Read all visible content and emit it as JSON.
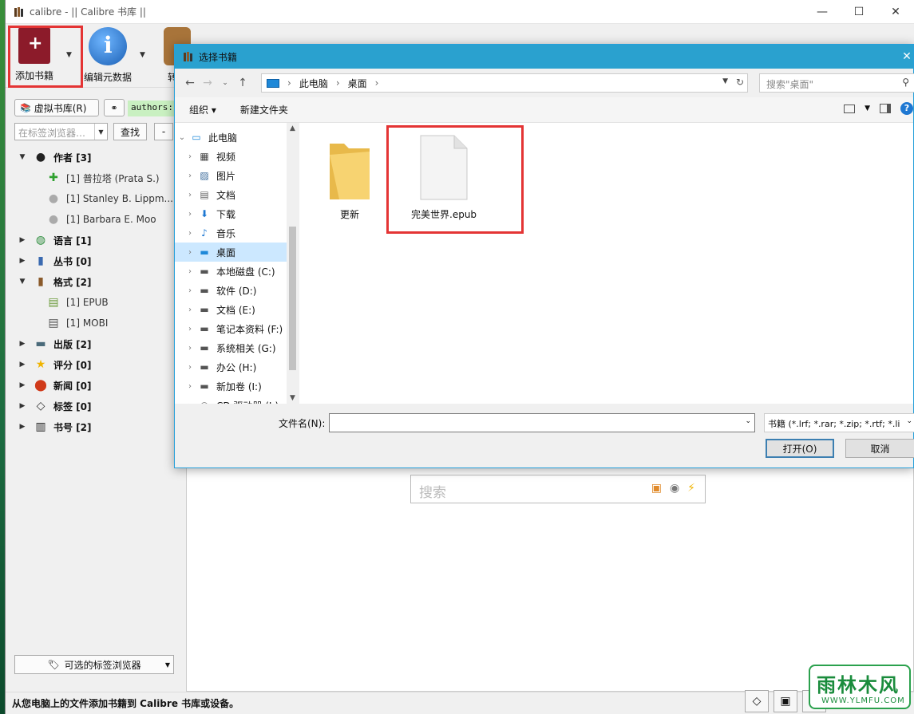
{
  "app": {
    "title": "calibre - || Calibre 书库 ||",
    "win_min": "—",
    "win_max": "☐",
    "win_close": "✕"
  },
  "toolbar": {
    "add_books": "添加书籍",
    "edit_metadata": "编辑元数据",
    "convert": "转换"
  },
  "left": {
    "virtual_library": "虚拟书库(R)",
    "search_text": "authors:\"",
    "tag_search_placeholder": "在标签浏览器…",
    "find": "查找",
    "minus": "-",
    "tree": [
      {
        "label": "作者 [3]",
        "icon": "person-icon",
        "expanded": true
      },
      {
        "label": "[1] 普拉塔 (Prata S.)",
        "child": true,
        "icon": "green-plus-icon"
      },
      {
        "label": "[1] Stanley B. Lippm...",
        "child": true,
        "icon": "person-gray-icon"
      },
      {
        "label": "[1] Barbara E. Moo",
        "child": true,
        "icon": "person-gray-icon"
      },
      {
        "label": "语言 [1]",
        "icon": "globe-icon"
      },
      {
        "label": "丛书 [0]",
        "icon": "series-icon"
      },
      {
        "label": "格式 [2]",
        "icon": "book-brown-icon",
        "expanded": true
      },
      {
        "label": "[1] EPUB",
        "child": true,
        "icon": "epub-icon"
      },
      {
        "label": "[1] MOBI",
        "child": true,
        "icon": "mobi-icon"
      },
      {
        "label": "出版 [2]",
        "icon": "publisher-icon"
      },
      {
        "label": "评分 [0]",
        "icon": "star-icon"
      },
      {
        "label": "新闻 [0]",
        "icon": "news-icon"
      },
      {
        "label": "标签 [0]",
        "icon": "tag-icon"
      },
      {
        "label": "书号 [2]",
        "icon": "barcode-icon"
      }
    ],
    "tag_browser_button": "可选的标签浏览器"
  },
  "center": {
    "search_placeholder": "搜索"
  },
  "status": {
    "message": "从您电脑上的文件添加书籍到 Calibre 书库或设备。"
  },
  "dialog": {
    "title": "选择书籍",
    "breadcrumb": [
      "此电脑",
      "桌面"
    ],
    "search_placeholder": "搜索\"桌面\"",
    "organize": "组织 ▾",
    "new_folder": "新建文件夹",
    "nav": [
      {
        "label": "此电脑",
        "icon": "computer-icon",
        "expanded": true,
        "level": 0
      },
      {
        "label": "视频",
        "icon": "video-icon"
      },
      {
        "label": "图片",
        "icon": "picture-icon"
      },
      {
        "label": "文档",
        "icon": "document-icon"
      },
      {
        "label": "下载",
        "icon": "download-icon"
      },
      {
        "label": "音乐",
        "icon": "music-icon"
      },
      {
        "label": "桌面",
        "icon": "desktop-icon",
        "selected": true
      },
      {
        "label": "本地磁盘 (C:)",
        "icon": "drive-icon"
      },
      {
        "label": "软件 (D:)",
        "icon": "drive-icon"
      },
      {
        "label": "文档 (E:)",
        "icon": "drive-icon"
      },
      {
        "label": "笔记本资料 (F:)",
        "icon": "drive-icon"
      },
      {
        "label": "系统相关 (G:)",
        "icon": "drive-icon"
      },
      {
        "label": "办公 (H:)",
        "icon": "drive-icon"
      },
      {
        "label": "新加卷 (I:)",
        "icon": "drive-icon"
      },
      {
        "label": "CD 驱动器 (J:)",
        "icon": "cd-icon"
      }
    ],
    "files": [
      {
        "name": "更新",
        "type": "folder"
      },
      {
        "name": "完美世界.epub",
        "type": "file"
      }
    ],
    "filename_label": "文件名(N):",
    "filename_value": "",
    "filetype": "书籍 (*.lrf; *.rar; *.zip; *.rtf; *.li",
    "open": "打开(O)",
    "cancel": "取消"
  },
  "watermark": {
    "title": "雨林木风",
    "url": "WWW.YLMFU.COM"
  },
  "colors": {
    "highlight_red": "#e43434",
    "dialog_title": "#2aa1cf",
    "selection": "#cce8ff"
  }
}
